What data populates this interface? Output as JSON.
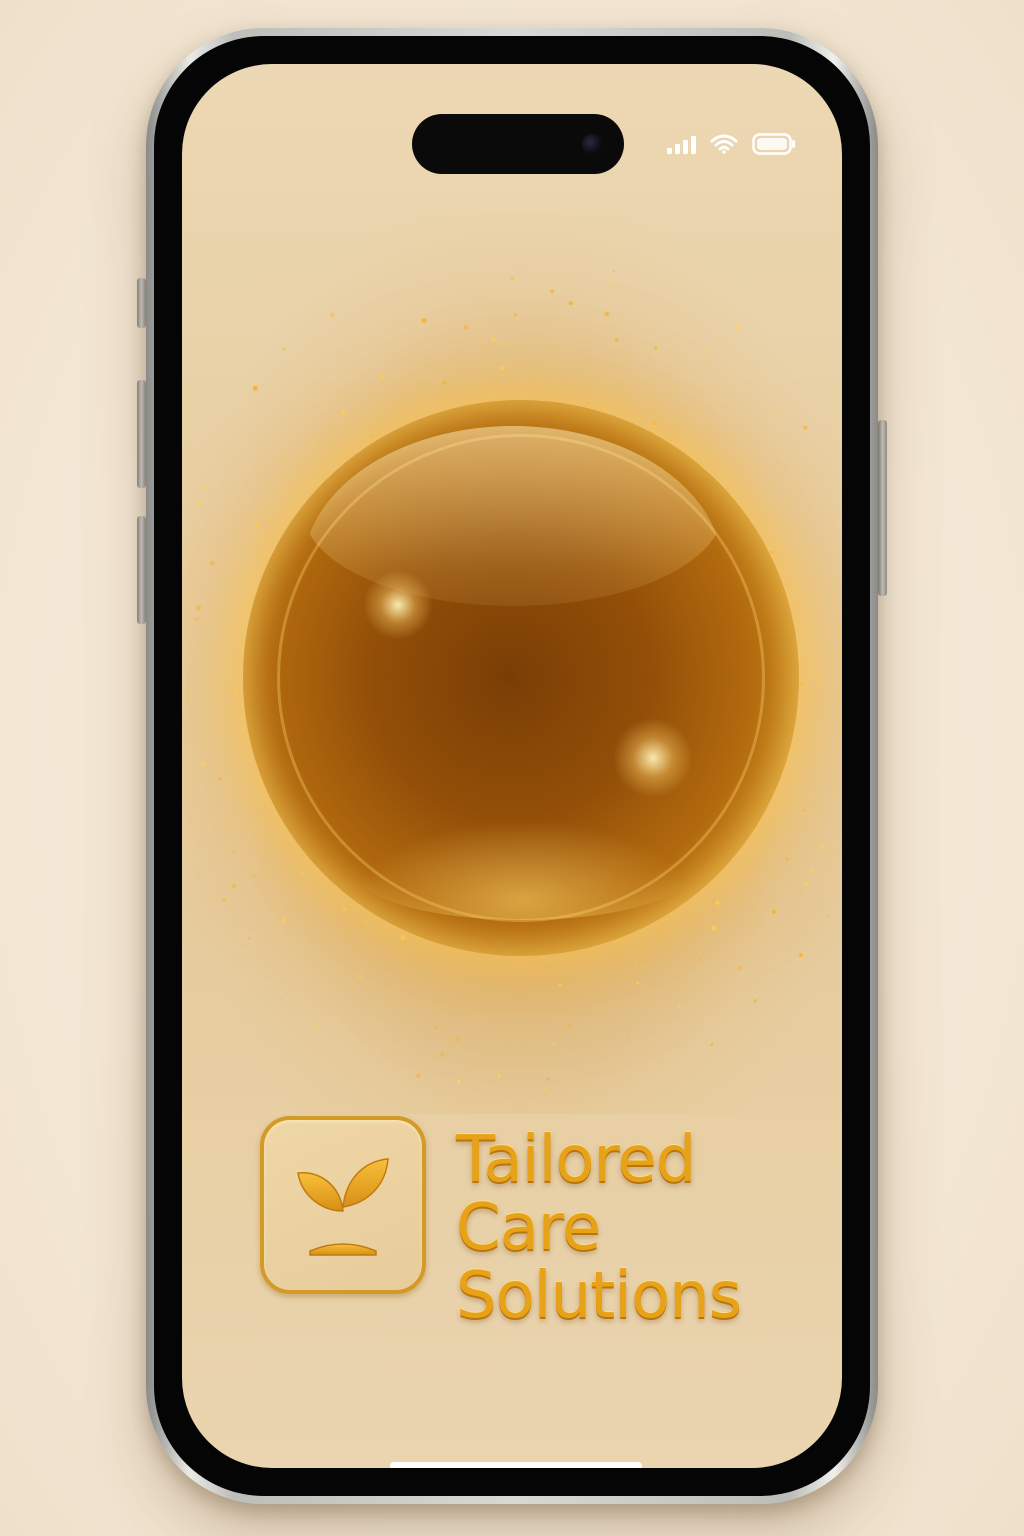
{
  "status_bar": {
    "signal_icon": "cellular-signal-icon",
    "wifi_icon": "wifi-icon",
    "battery_icon": "battery-icon"
  },
  "hero": {
    "graphic": "glowing-golden-orb"
  },
  "brand": {
    "icon": "sprout-icon",
    "name_lines": [
      "Tailored",
      "Care",
      "Solutions"
    ]
  },
  "colors": {
    "accent": "#e8a218",
    "orb_glow": "#f4c64a",
    "screen_background": "#e8cfa3",
    "status_icons": "#ffffff"
  }
}
